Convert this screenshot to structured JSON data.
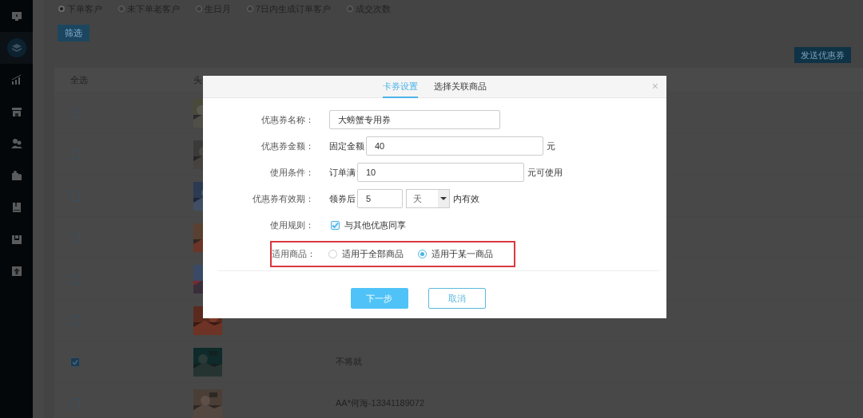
{
  "sidebar": {
    "items": [
      {
        "kind": "monitor",
        "selected": false
      },
      {
        "kind": "layers",
        "selected": true
      },
      {
        "kind": "chart",
        "selected": false
      },
      {
        "kind": "store",
        "selected": false
      },
      {
        "kind": "users",
        "selected": false
      },
      {
        "kind": "puzzle",
        "selected": false
      },
      {
        "kind": "book",
        "selected": false
      },
      {
        "kind": "tray",
        "selected": false
      },
      {
        "kind": "upload",
        "selected": false
      }
    ]
  },
  "filters": [
    {
      "label": "下单客户",
      "selected": true
    },
    {
      "label": "未下单老客户",
      "selected": false
    },
    {
      "label": "生日月",
      "selected": false
    },
    {
      "label": "7日内生成订单客户",
      "selected": false
    },
    {
      "label": "成交次数",
      "selected": false
    }
  ],
  "filter_button": "筛选",
  "send_button": "发送优惠券",
  "table": {
    "columns": [
      "全选",
      "头"
    ],
    "rows": [
      {
        "checked": false
      },
      {
        "checked": false
      },
      {
        "checked": false
      },
      {
        "checked": false
      },
      {
        "checked": false
      },
      {
        "checked": false
      },
      {
        "checked": true,
        "name": "不将就"
      },
      {
        "checked": false,
        "name": "AA*何海-13341189072"
      }
    ]
  },
  "dialog": {
    "tabs": [
      {
        "label": "卡券设置",
        "selected": true
      },
      {
        "label": "选择关联商品",
        "selected": false
      }
    ],
    "close": "×",
    "fields": [
      {
        "kind": "text",
        "label": "优惠券名称：",
        "value": "大螃蟹专用券"
      },
      {
        "kind": "text",
        "label": "优惠券金额：",
        "prefix": "固定金额",
        "value": "40",
        "suffix": "元"
      },
      {
        "kind": "text",
        "label": "使用条件：",
        "prefix": "订单满",
        "value": "10",
        "suffix": "元可使用"
      },
      {
        "kind": "period",
        "label": "优惠券有效期：",
        "prefix": "领券后",
        "value": "5",
        "unit": "天",
        "suffix": "内有效"
      },
      {
        "kind": "checkbox",
        "label": "使用规则：",
        "checked": true,
        "text": "与其他优惠同享"
      },
      {
        "kind": "radio",
        "label": "适用商品：",
        "highlighted": true,
        "options": [
          {
            "label": "适用于全部商品",
            "selected": false
          },
          {
            "label": "适用于某一商品",
            "selected": true
          }
        ]
      }
    ],
    "buttons": [
      {
        "kind": "primary",
        "label": "下一步"
      },
      {
        "kind": "secondary",
        "label": "取消"
      }
    ]
  }
}
